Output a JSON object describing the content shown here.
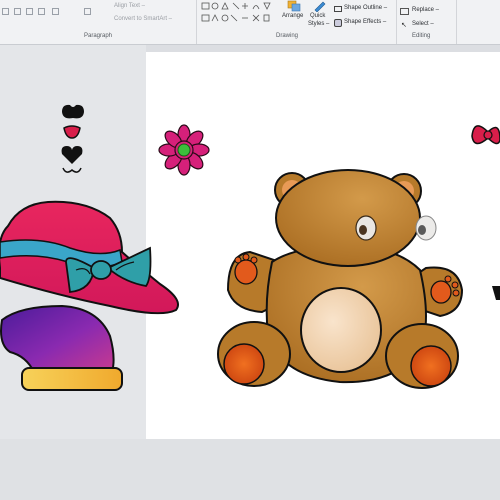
{
  "ribbon": {
    "paragraph": {
      "label": "Paragraph",
      "align_text": "Align Text –",
      "convert_smartart": "Convert to SmartArt –"
    },
    "drawing": {
      "label": "Drawing",
      "arrange": "Arrange",
      "quick_styles_1": "Quick",
      "quick_styles_2": "Styles –",
      "shape_outline": "Shape Outline –",
      "shape_effects": "Shape Effects –"
    },
    "editing": {
      "label": "Editing",
      "replace": "Replace –",
      "select": "Select –"
    }
  },
  "colors": {
    "hat_red": "#e8265e",
    "hat_band": "#3aa6c9",
    "bow_teal": "#2f9fa8",
    "bear_brown": "#b77a2a",
    "bear_paw": "#e25a1c",
    "flower_magenta": "#d6207a",
    "flower_center": "#3bbf3b",
    "purple_hat": "#6b1f9e",
    "hat_brim_yellow": "#f5c445",
    "bow_red": "#d81e4a"
  },
  "icons": [
    "hat-shape",
    "bow-tie-shape",
    "teddy-bear-shape",
    "flower-shape",
    "bow-shape",
    "face-parts-shape",
    "party-hat-shape"
  ]
}
